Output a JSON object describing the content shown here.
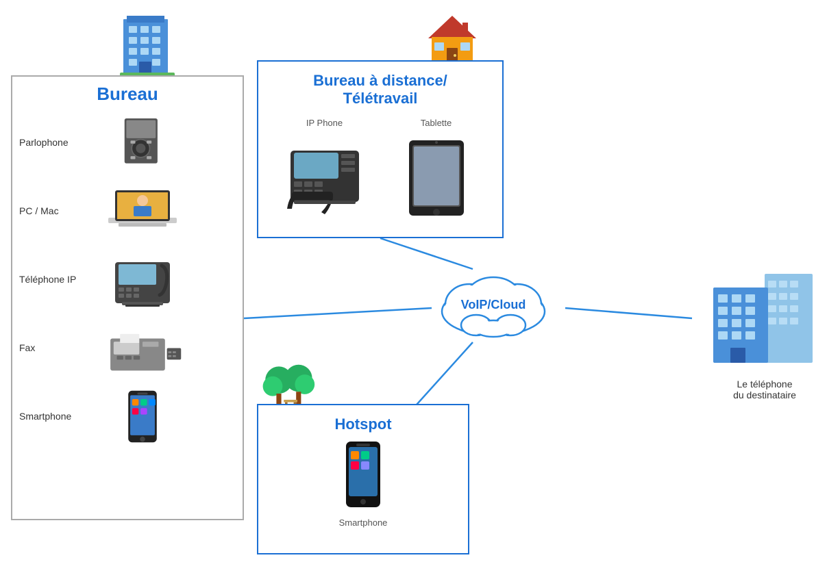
{
  "bureau": {
    "title": "Bureau",
    "items": [
      {
        "label": "Parlophone",
        "icon": "parlophone"
      },
      {
        "label": "PC / Mac",
        "icon": "pc-mac"
      },
      {
        "label": "Téléphone IP",
        "icon": "ip-phone-small"
      },
      {
        "label": "Fax",
        "icon": "fax"
      },
      {
        "label": "Smartphone",
        "icon": "smartphone-small"
      }
    ]
  },
  "remote": {
    "title": "Bureau à distance/ Télétravail",
    "items": [
      {
        "label": "IP Phone",
        "icon": "ip-phone"
      },
      {
        "label": "Tablette",
        "icon": "tablet"
      }
    ]
  },
  "hotspot": {
    "title": "Hotspot",
    "items": [
      {
        "label": "Smartphone",
        "icon": "smartphone"
      }
    ]
  },
  "voip": {
    "label": "VoIP/Cloud"
  },
  "destination": {
    "label": "Le téléphone\ndu destinataire"
  },
  "colors": {
    "blue": "#1a6fd4",
    "lineBlue": "#2b8ae0"
  }
}
